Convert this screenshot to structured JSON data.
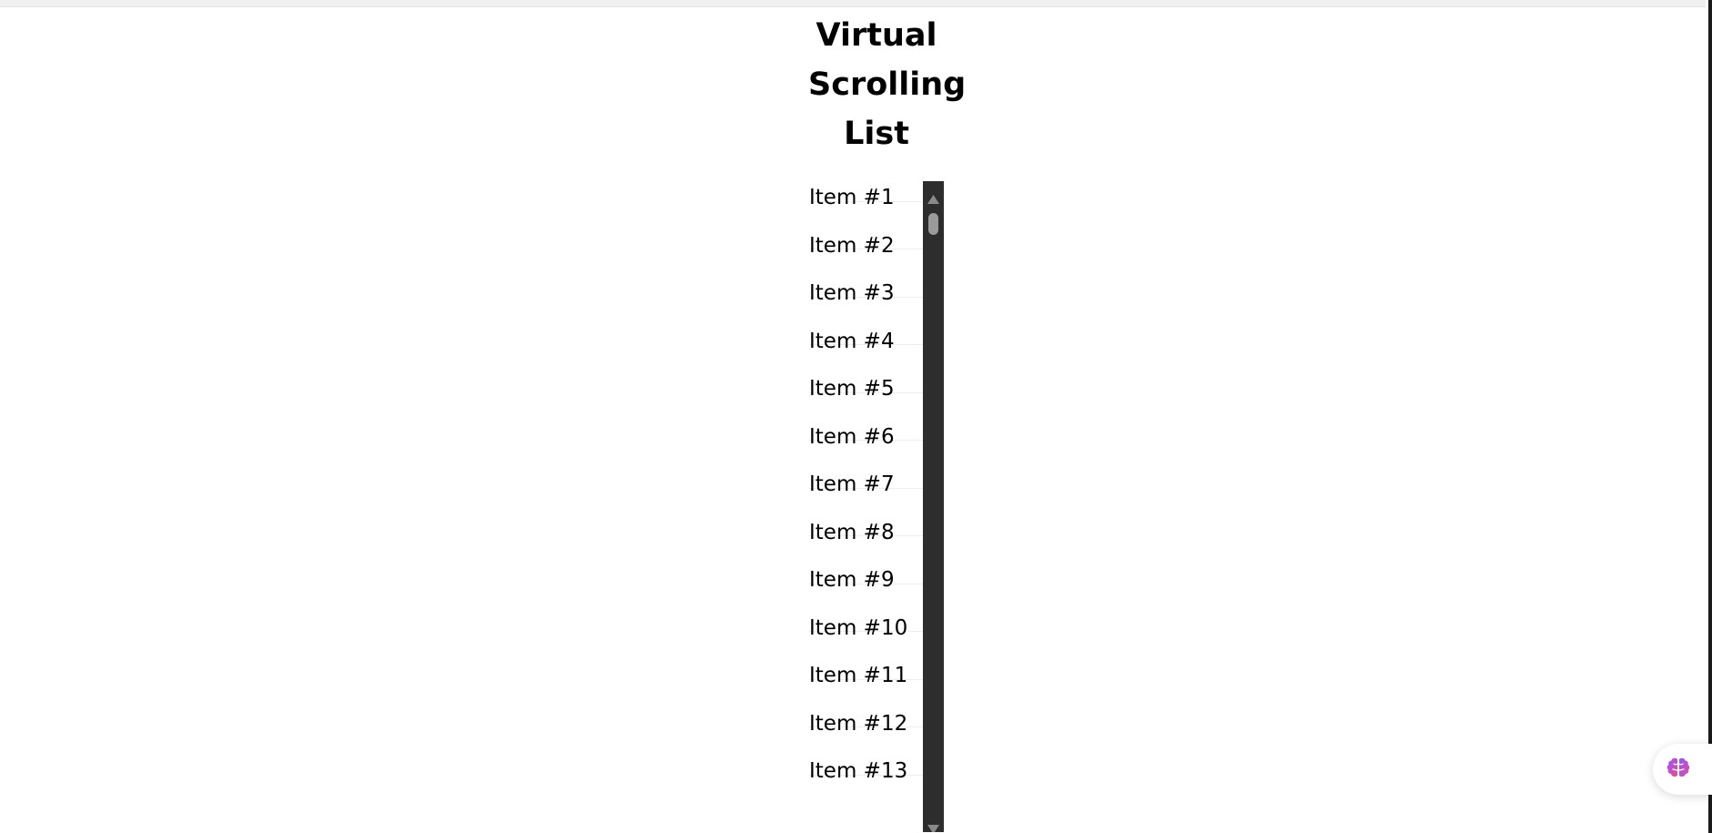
{
  "page": {
    "title": "Virtual\nScrolling\nList"
  },
  "list": {
    "items": [
      {
        "label": "Item #1"
      },
      {
        "label": "Item #2"
      },
      {
        "label": "Item #3"
      },
      {
        "label": "Item #4"
      },
      {
        "label": "Item #5"
      },
      {
        "label": "Item #6"
      },
      {
        "label": "Item #7"
      },
      {
        "label": "Item #8"
      },
      {
        "label": "Item #9"
      },
      {
        "label": "Item #10"
      },
      {
        "label": "Item #11"
      },
      {
        "label": "Item #12"
      },
      {
        "label": "Item #13"
      }
    ],
    "scroll_position": 0
  },
  "icons": {
    "scroll_up": "chevron-up-icon",
    "scroll_down": "chevron-down-icon",
    "assistant": "brain-icon"
  },
  "colors": {
    "scrollbar_track": "#2d2d2d",
    "scrollbar_thumb": "#9a9a9a",
    "assistant_icon_start": "#8b5cf6",
    "assistant_icon_end": "#ec4899"
  }
}
